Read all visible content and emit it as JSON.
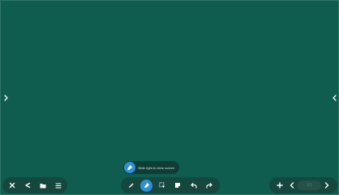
{
  "colors": {
    "board": "#0f5d4f",
    "toolbar": "#16473f",
    "accent": "#2f8fd8",
    "icon": "#ffffff"
  },
  "navigation": {
    "prev_icon": "chevron-left-icon",
    "next_icon": "chevron-right-icon"
  },
  "left_toolbar": {
    "items": [
      "close-icon",
      "share-icon",
      "folder-icon",
      "menu-icon"
    ]
  },
  "center_toolbar": {
    "items": [
      "pen-icon",
      "eraser-icon",
      "select-icon",
      "note-icon",
      "undo-icon",
      "redo-icon"
    ],
    "active_tool": "eraser-icon"
  },
  "tooltip": {
    "text": "Slide right to clear screen",
    "icon": "eraser-icon"
  },
  "right_toolbar": {
    "items": [
      "add-page-icon",
      "prev-page-icon",
      "next-page-icon"
    ],
    "page_indicator": "1/1"
  }
}
